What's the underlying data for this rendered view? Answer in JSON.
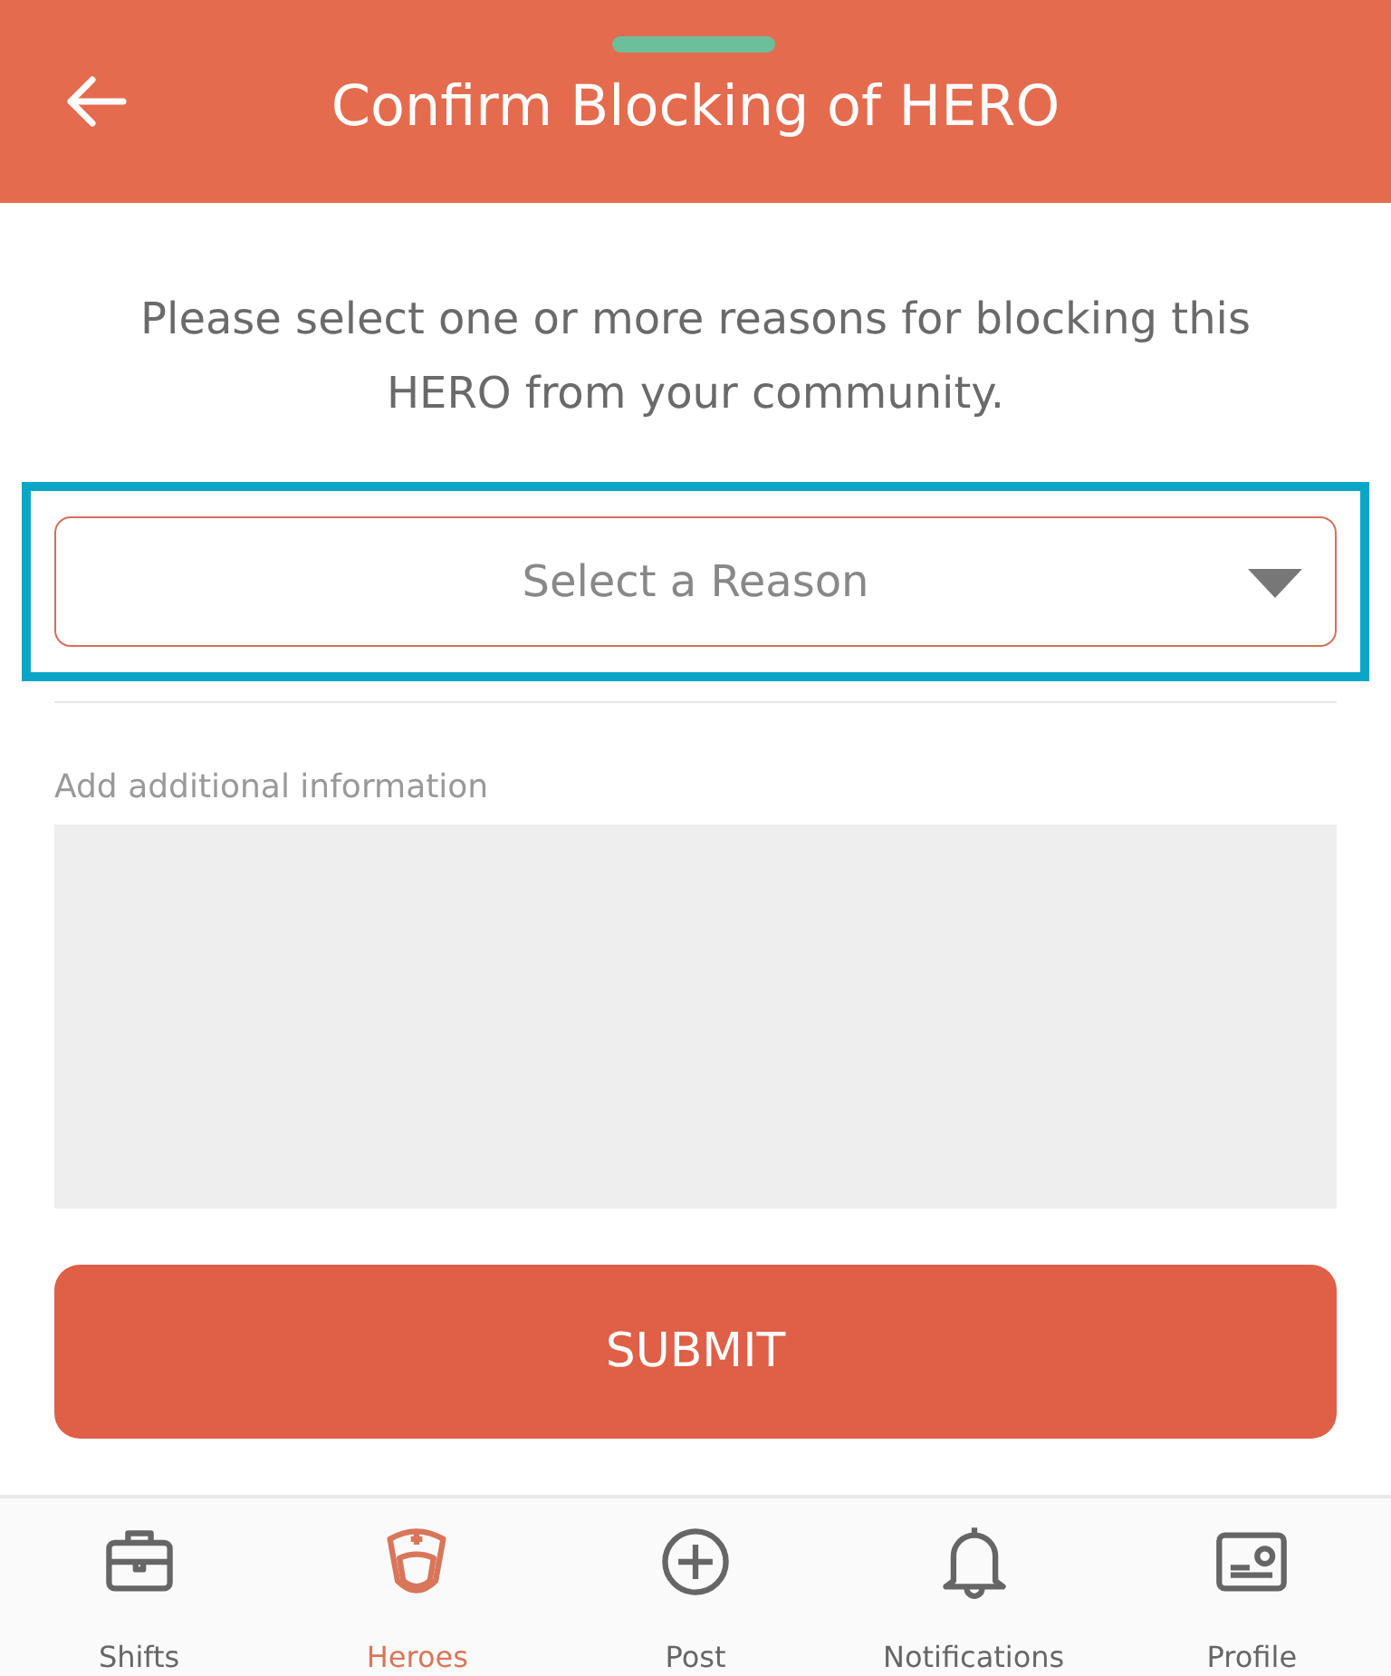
{
  "header": {
    "title": "Confirm Blocking of HERO"
  },
  "intro": "Please select one or more reasons for blocking this HERO from your community.",
  "reason_select": {
    "placeholder": "Select a Reason",
    "highlighted": true
  },
  "details": {
    "label": "Add additional information"
  },
  "submit": "SUBMIT",
  "nav": [
    {
      "kind": "shifts",
      "label": "Shifts",
      "selected": false
    },
    {
      "kind": "heroes",
      "label": "Heroes",
      "selected": true
    },
    {
      "kind": "post",
      "label": "Post",
      "selected": false
    },
    {
      "kind": "notifications",
      "label": "Notifications",
      "selected": false
    },
    {
      "kind": "profile",
      "label": "Profile",
      "selected": false
    }
  ]
}
